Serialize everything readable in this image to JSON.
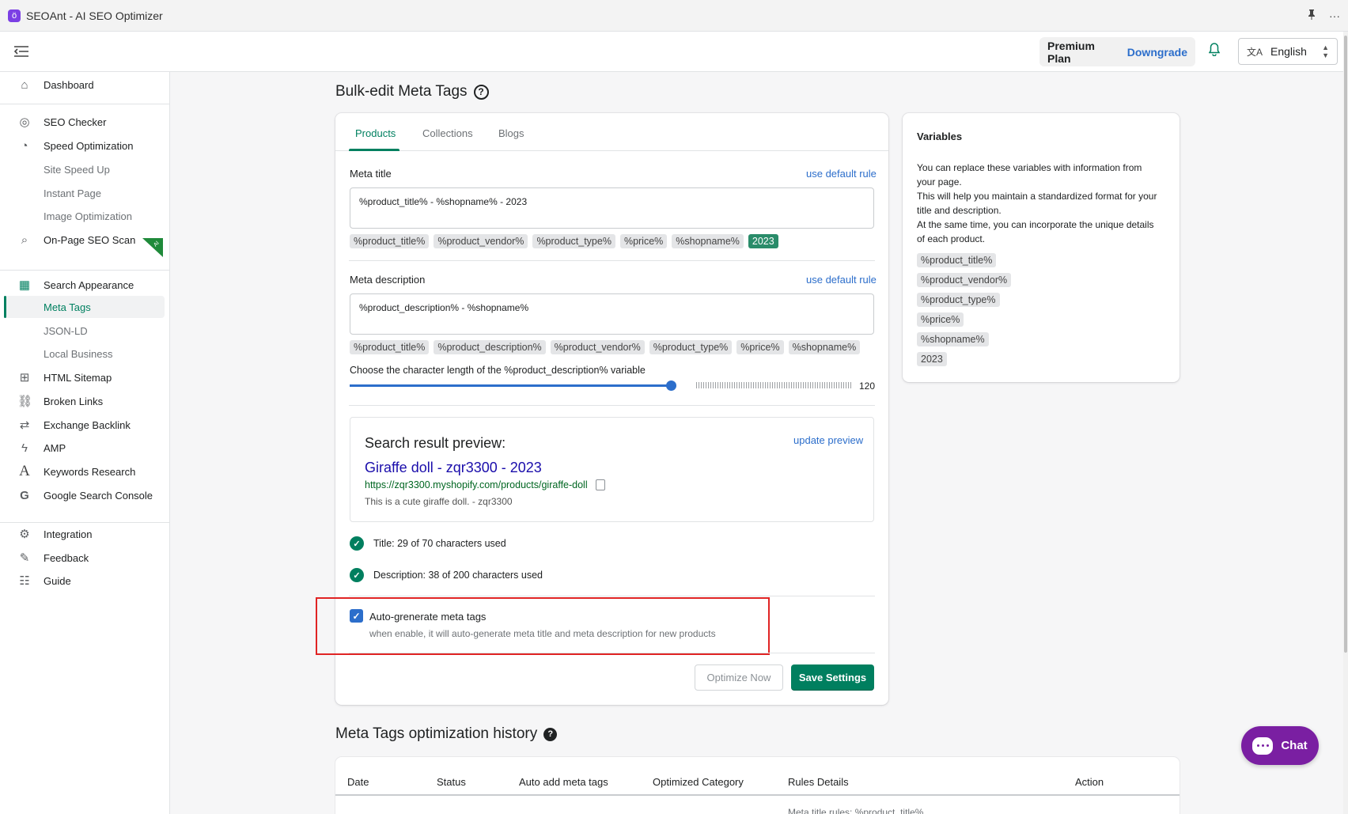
{
  "app": {
    "title": "SEOAnt - AI SEO Optimizer",
    "logo_glyph": "ö",
    "pin_icon": "pin-icon",
    "more_glyph": "···"
  },
  "header": {
    "plan_name": "Premium Plan",
    "plan_action": "Downgrade",
    "language": "English",
    "bell_glyph": "🔔",
    "translate_glyph": "文A"
  },
  "sidebar": {
    "items": [
      {
        "label": "Dashboard",
        "icon": "home-icon",
        "glyph": "⌂"
      },
      {
        "label": "SEO Checker",
        "icon": "seo-checker-icon",
        "glyph": "◎"
      },
      {
        "label": "Speed Optimization",
        "icon": "speedometer-icon",
        "glyph": "◔"
      },
      {
        "label": "Site Speed Up"
      },
      {
        "label": "Instant Page"
      },
      {
        "label": "Image Optimization"
      },
      {
        "label": "On-Page SEO Scan",
        "icon": "search-icon",
        "glyph": "⌕",
        "badge": "AI"
      },
      {
        "label": "Search Appearance",
        "icon": "search-appearance-icon",
        "glyph": "▦"
      },
      {
        "label": "Meta Tags"
      },
      {
        "label": "JSON-LD"
      },
      {
        "label": "Local Business"
      },
      {
        "label": "HTML Sitemap",
        "icon": "sitemap-icon",
        "glyph": "⊞"
      },
      {
        "label": "Broken Links",
        "icon": "broken-link-icon",
        "glyph": "⛓"
      },
      {
        "label": "Exchange Backlink",
        "icon": "exchange-icon",
        "glyph": "⇄"
      },
      {
        "label": "AMP",
        "icon": "lightning-icon",
        "glyph": "ϟ"
      },
      {
        "label": "Keywords Research",
        "icon": "keywords-icon",
        "glyph": "A"
      },
      {
        "label": "Google Search Console",
        "icon": "google-icon",
        "glyph": "G"
      },
      {
        "label": "Integration",
        "icon": "integration-icon",
        "glyph": "⚙"
      },
      {
        "label": "Feedback",
        "icon": "feedback-icon",
        "glyph": "✎"
      },
      {
        "label": "Guide",
        "icon": "guide-icon",
        "glyph": "☷"
      }
    ]
  },
  "main": {
    "title": "Bulk-edit Meta Tags",
    "help_glyph": "?",
    "tabs": [
      "Products",
      "Collections",
      "Blogs"
    ],
    "meta_title": {
      "label": "Meta title",
      "link": "use default rule",
      "value": "%product_title% - %shopname% - 2023",
      "tags": [
        "%product_title%",
        "%product_vendor%",
        "%product_type%",
        "%price%",
        "%shopname%",
        "2023"
      ]
    },
    "meta_description": {
      "label": "Meta description",
      "link": "use default rule",
      "value": "%product_description% - %shopname%",
      "tags": [
        "%product_title%",
        "%product_description%",
        "%product_vendor%",
        "%product_type%",
        "%price%",
        "%shopname%"
      ]
    },
    "slider": {
      "label": "Choose the character length of the %product_description% variable",
      "value": 120,
      "fraction": 0.64
    },
    "preview": {
      "heading": "Search result preview:",
      "link": "update preview",
      "title": "Giraffe doll - zqr3300 - 2023",
      "url": "https://zqr3300.myshopify.com/products/giraffe-doll",
      "description": "This is a cute giraffe doll. - zqr3300"
    },
    "checks": [
      "Title: 29 of 70 characters used",
      "Description: 38 of 200 characters used"
    ],
    "auto_generate": {
      "title": "Auto-grenerate meta tags",
      "subtitle": "when enable, it will auto-generate meta title and meta description for new products",
      "checked": true
    },
    "buttons": {
      "optimize": "Optimize Now",
      "save": "Save Settings"
    }
  },
  "variables": {
    "title": "Variables",
    "desc_lines": [
      "You can replace these variables with information from your page.",
      "This will help you maintain a standardized format for your title and description.",
      "At the same time, you can incorporate the unique details of each product."
    ],
    "tags": [
      "%product_title%",
      "%product_vendor%",
      "%product_type%",
      "%price%",
      "%shopname%",
      "2023"
    ]
  },
  "history": {
    "title": "Meta Tags optimization history",
    "columns": [
      "Date",
      "Status",
      "Auto add meta tags",
      "Optimized Category",
      "Rules Details",
      "Action"
    ],
    "first_row_rules": "Meta title rules: %product_title%"
  },
  "chat": {
    "label": "Chat"
  },
  "colors": {
    "accent": "#008060",
    "link": "#2c6ecb",
    "highlight": "#e02424",
    "chat": "#7a1fa2"
  }
}
